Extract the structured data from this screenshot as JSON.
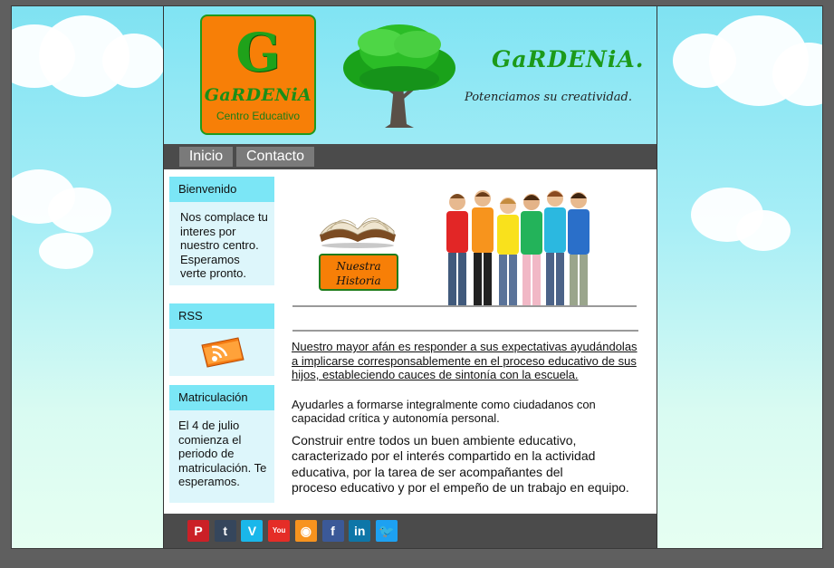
{
  "header": {
    "logo_letter": "G",
    "logo_name": "GaRDENiA",
    "logo_subtitle": "Centro Educativo",
    "site_title": "GaRDENiA.",
    "tagline": "Potenciamos su creatividad."
  },
  "nav": {
    "items": [
      "Inicio",
      "Contacto"
    ]
  },
  "sidebar": {
    "welcome": {
      "title": "Bienvenido",
      "text": "Nos complace tu interes por nuestro centro. Esperamos verte pronto."
    },
    "rss": {
      "title": "RSS",
      "icon": "rss-feed-icon"
    },
    "enrollment": {
      "title": "Matriculación",
      "text": "El 4 de julio comienza el periodo de matriculación. Te esperamos."
    }
  },
  "main": {
    "history_button": "Nuestra Historia",
    "book_icon": "open-book-icon",
    "photo": "children-group-photo",
    "paragraph_1": "Nuestro mayor afán es responder a sus expectativas ayudándolas a implicarse corresponsablemente en el proceso educativo de sus hijos, estableciendo cauces de sintonía con la escuela.",
    "paragraph_2": "Ayudarles a formarse integralmente como ciudadanos con capacidad crítica y autonomía personal.",
    "paragraph_3": "Construir entre todos un buen ambiente educativo,\n caracterizado por el interés compartido en la actividad educativa, por la tarea de ser acompañantes del\nproceso educativo y por el empeño de un trabajo en equipo."
  },
  "footer": {
    "social": [
      {
        "name": "pinterest-icon",
        "glyph": "P",
        "color": "#cb2027"
      },
      {
        "name": "tumblr-icon",
        "glyph": "t",
        "color": "#35465c"
      },
      {
        "name": "vimeo-icon",
        "glyph": "V",
        "color": "#1ab7ea"
      },
      {
        "name": "youtube-icon",
        "glyph": "You",
        "color": "#e52d27"
      },
      {
        "name": "rss-icon",
        "glyph": "◉",
        "color": "#f7931e"
      },
      {
        "name": "facebook-icon",
        "glyph": "f",
        "color": "#3b5998"
      },
      {
        "name": "linkedin-icon",
        "glyph": "in",
        "color": "#0e76a8"
      },
      {
        "name": "twitter-icon",
        "glyph": "🐦",
        "color": "#1da1f2"
      }
    ]
  }
}
